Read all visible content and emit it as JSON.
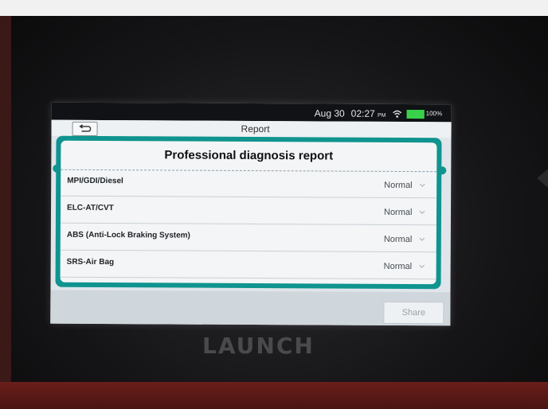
{
  "status_bar": {
    "date": "Aug 30",
    "time": "02:27",
    "ampm": "PM",
    "battery": "100%",
    "icons": [
      "wifi-icon",
      "battery-icon"
    ]
  },
  "header": {
    "title": "Report",
    "back_icon": "back-arrow-icon"
  },
  "report": {
    "title": "Professional diagnosis report",
    "rows": [
      {
        "label": "MPI/GDI/Diesel",
        "status": "Normal"
      },
      {
        "label": "ELC-AT/CVT",
        "status": "Normal"
      },
      {
        "label": "ABS (Anti-Lock Braking System)",
        "status": "Normal"
      },
      {
        "label": "SRS-Air Bag",
        "status": "Normal"
      }
    ]
  },
  "footer": {
    "share_label": "Share"
  },
  "device": {
    "brand_logo": "LAUNCH"
  },
  "colors": {
    "accent": "#0f948f",
    "battery": "#3ad14a"
  }
}
